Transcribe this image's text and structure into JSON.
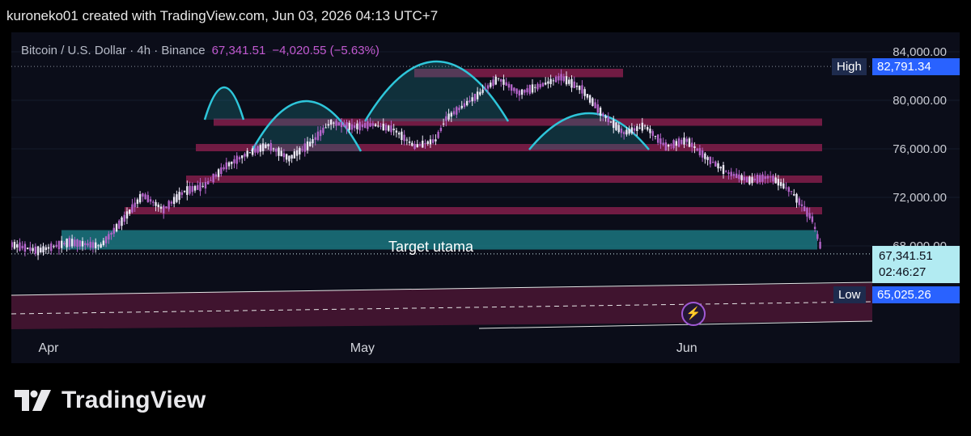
{
  "header": {
    "attribution": "kuroneko01 created with TradingView.com, Jun 03, 2026 04:13 UTC+7"
  },
  "legend": {
    "symbol": "Bitcoin / U.S. Dollar · 4h · Binance",
    "price": "67,341.51",
    "change": "−4,020.55 (−5.63%)"
  },
  "labels": {
    "high_tag": "High",
    "high_value": "82,791.34",
    "low_tag": "Low",
    "low_value": "65,025.26",
    "current_price": "67,341.51",
    "countdown": "02:46:27",
    "target_zone": "Target utama"
  },
  "footer": {
    "brand": "TradingView"
  },
  "colors": {
    "background": "#0b0d19",
    "zone": "#8b1f4e",
    "target_zone": "#1b7d86",
    "arc": "#2ec6da",
    "price_tag": "#2962ff",
    "current_price_tag": "#b2ebf2"
  },
  "chart_data": {
    "type": "candlestick",
    "symbol": "Bitcoin / U.S. Dollar",
    "interval": "4h",
    "exchange": "Binance",
    "y_axis": {
      "ticks": [
        84000,
        80000,
        76000,
        72000,
        68000
      ],
      "tick_labels": [
        "84,000.00",
        "80,000.00",
        "76,000.00",
        "72,000.00",
        "68,000.00"
      ]
    },
    "x_axis": {
      "tick_labels": [
        "Apr",
        "May",
        "Jun"
      ]
    },
    "resistance_zones": [
      {
        "low": 81900,
        "high": 82600
      },
      {
        "low": 77900,
        "high": 78500
      },
      {
        "low": 75800,
        "high": 76400
      },
      {
        "low": 73200,
        "high": 73800
      },
      {
        "low": 70600,
        "high": 71200
      }
    ],
    "target_zone": {
      "label": "Target utama",
      "low": 67700,
      "high": 69300
    },
    "high": 82791.34,
    "low": 65025.26,
    "last_price": 67341.51,
    "price_path": [
      [
        "03-24",
        67500
      ],
      [
        "03-28",
        68200
      ],
      [
        "03-31",
        67600
      ],
      [
        "04-03",
        68300
      ],
      [
        "04-06",
        68000
      ],
      [
        "04-08",
        70000
      ],
      [
        "04-10",
        72200
      ],
      [
        "04-12",
        71000
      ],
      [
        "04-14",
        72500
      ],
      [
        "04-16",
        73000
      ],
      [
        "04-18",
        74600
      ],
      [
        "04-20",
        75600
      ],
      [
        "04-22",
        76300
      ],
      [
        "04-24",
        75200
      ],
      [
        "04-26",
        76400
      ],
      [
        "04-28",
        78200
      ],
      [
        "04-30",
        77800
      ],
      [
        "05-02",
        78000
      ],
      [
        "05-04",
        77600
      ],
      [
        "05-06",
        76200
      ],
      [
        "05-08",
        76700
      ],
      [
        "05-09",
        78500
      ],
      [
        "05-12",
        80400
      ],
      [
        "05-14",
        81800
      ],
      [
        "05-16",
        80600
      ],
      [
        "05-18",
        81200
      ],
      [
        "05-20",
        81900
      ],
      [
        "05-22",
        80900
      ],
      [
        "05-24",
        78800
      ],
      [
        "05-26",
        77300
      ],
      [
        "05-28",
        77900
      ],
      [
        "05-30",
        76200
      ],
      [
        "06-01",
        76700
      ],
      [
        "06-03",
        75200
      ],
      [
        "06-05",
        74000
      ],
      [
        "06-07",
        73400
      ],
      [
        "06-09",
        73700
      ],
      [
        "06-11",
        72500
      ],
      [
        "06-13",
        70200
      ],
      [
        "06-14",
        67341.51
      ]
    ]
  }
}
